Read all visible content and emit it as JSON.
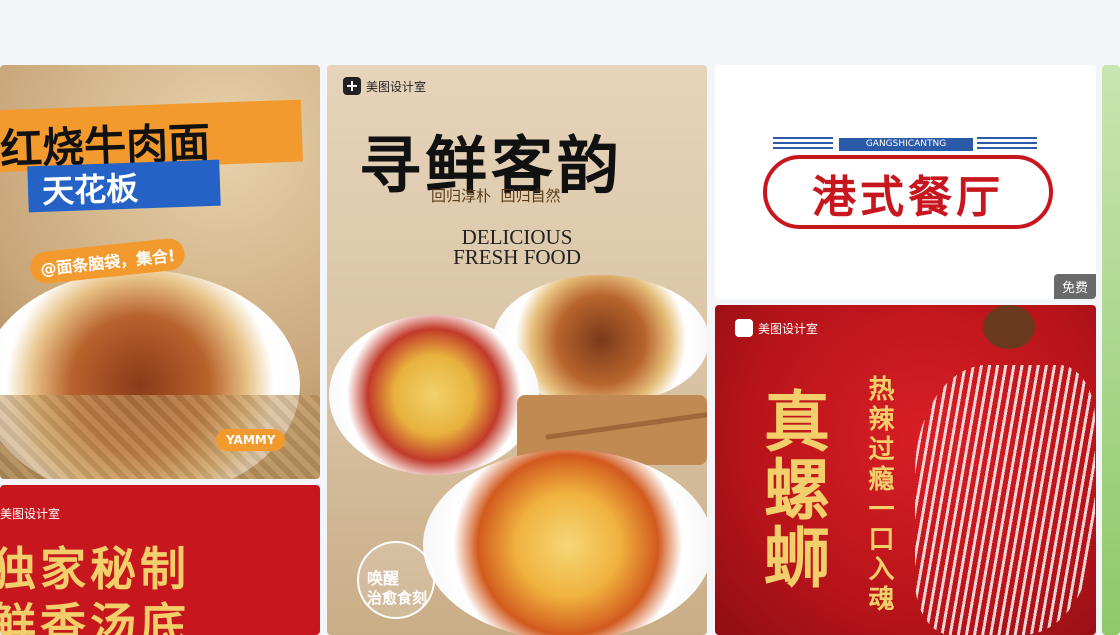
{
  "cards": {
    "beef_noodle": {
      "headline": "红烧牛肉面",
      "subtitle": "天花板",
      "tagline": "@面条脑袋，集合!",
      "badge": "YAMMY"
    },
    "fresh_noodle": {
      "brand": "美图设计室",
      "title": "寻鲜客韵",
      "slogan": "回归淳朴  回归自然",
      "en_line1": "DELICIOUS",
      "en_line2": "FRESH FOOD",
      "corner_line1": "唤醒",
      "corner_line2": "治愈食刻"
    },
    "hk_restaurant": {
      "small": "GANGSHICANTNG",
      "title": "港式餐厅",
      "free_badge": "免费"
    },
    "snail_noodle": {
      "brand": "美图设计室",
      "big_title": "真螺蛳",
      "vertical": "热辣过瘾一口入魂"
    },
    "secret_soup": {
      "brand": "美图设计室",
      "line1": "独家秘制",
      "line2": "鲜香汤底"
    }
  },
  "colors": {
    "red": "#c8161e",
    "gold": "#f2cf6a",
    "orange": "#f39a2e",
    "blue": "#2462c6"
  }
}
